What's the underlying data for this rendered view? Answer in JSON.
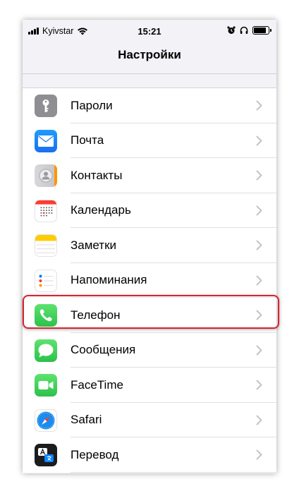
{
  "status_bar": {
    "carrier": "Kyivstar",
    "time": "15:21",
    "battery_level": 0.85
  },
  "nav": {
    "title": "Настройки"
  },
  "settings_items": [
    {
      "label": "Пароли",
      "icon": "key-icon",
      "color": "#8e8e93"
    },
    {
      "label": "Почта",
      "icon": "mail-icon",
      "color": "#2f8cf6"
    },
    {
      "label": "Контакты",
      "icon": "contacts-icon",
      "color": "#b8b8bd"
    },
    {
      "label": "Календарь",
      "icon": "calendar-icon",
      "color": "#ffffff"
    },
    {
      "label": "Заметки",
      "icon": "notes-icon",
      "color": "#ffffff"
    },
    {
      "label": "Напоминания",
      "icon": "reminders-icon",
      "color": "#ffffff"
    },
    {
      "label": "Телефон",
      "icon": "phone-icon",
      "color": "#34c759"
    },
    {
      "label": "Сообщения",
      "icon": "messages-icon",
      "color": "#34c759"
    },
    {
      "label": "FaceTime",
      "icon": "facetime-icon",
      "color": "#34c759"
    },
    {
      "label": "Safari",
      "icon": "safari-icon",
      "color": "#ffffff"
    },
    {
      "label": "Перевод",
      "icon": "translate-icon",
      "color": "#1c1c1e"
    }
  ],
  "highlight": {
    "item": "Телефон",
    "color": "#d9232f"
  }
}
